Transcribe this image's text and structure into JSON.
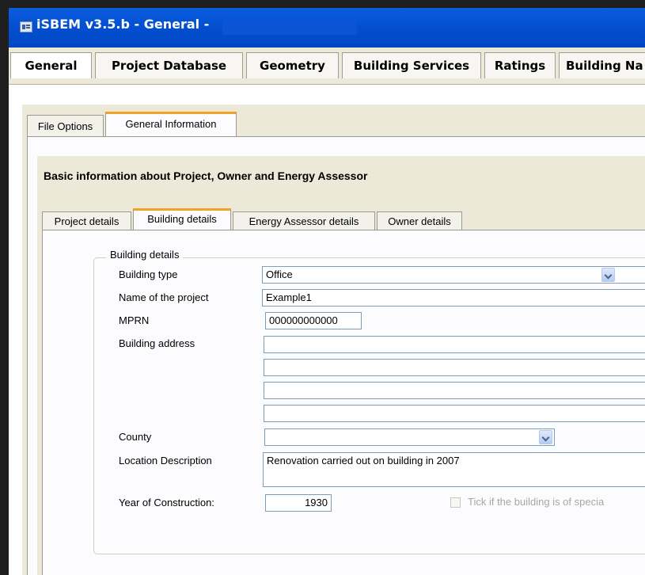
{
  "window": {
    "title": "iSBEM v3.5.b - General -"
  },
  "main_tabs": [
    "General",
    "Project Database",
    "Geometry",
    "Building Services",
    "Ratings",
    "Building Na"
  ],
  "sub_tabs": [
    {
      "label": "File Options",
      "active": false
    },
    {
      "label": "General Information",
      "active": true
    }
  ],
  "section": {
    "title": "Basic information about Project, Owner and Energy Assessor"
  },
  "detail_tabs": [
    {
      "label": "Project details",
      "active": false
    },
    {
      "label": "Building details",
      "active": true
    },
    {
      "label": "Energy Assessor details",
      "active": false
    },
    {
      "label": "Owner details",
      "active": false
    }
  ],
  "group": {
    "label": "Building details",
    "building_type_label": "Building type",
    "building_type_value": "Office",
    "project_name_label": "Name of the project",
    "project_name_value": "Example1",
    "mprn_label": "MPRN",
    "mprn_value": "000000000000",
    "address_label": "Building address",
    "address_lines": [
      "",
      "",
      "",
      ""
    ],
    "county_label": "County",
    "county_value": "",
    "location_label": "Location Description",
    "location_value": "Renovation carried out on building in 2007",
    "year_label": "Year of Construction:",
    "year_value": "1930",
    "special_checkbox_label": "Tick if the building is of specia",
    "special_checked": false
  },
  "icons": {
    "app": "app-form-icon",
    "dropdown": "chevron-down-icon"
  },
  "colors": {
    "titlebar": "#0350d0",
    "active_tab_accent": "#f2a22a",
    "field_border": "#7f9db9"
  }
}
